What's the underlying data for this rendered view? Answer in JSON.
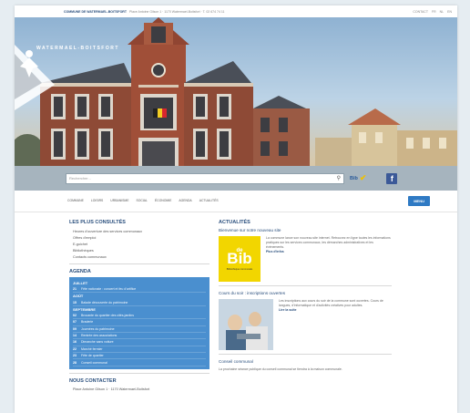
{
  "topbar": {
    "municipality": "COMMUNE DE WATERMAEL-BOITSFORT",
    "address": "Place Antoine Gilson 1 · 1170 Watermael-Boitsfort · T. 02 674 74 11",
    "right_links": [
      "CONTACT",
      "FR",
      "NL",
      "EN"
    ]
  },
  "hero": {
    "logo_text": "WATERMAEL-BOITSFORT"
  },
  "search": {
    "placeholder": "Rechercher...",
    "bib_label": "Bib"
  },
  "nav": {
    "items": [
      "COMMUNE",
      "LOISIRS",
      "URBANISME",
      "SOCIAL",
      "ÉCONOMIE",
      "AGENDA",
      "ACTUALITÉS"
    ],
    "menu_button": "MENU"
  },
  "left": {
    "most_consulted": {
      "title": "LES PLUS CONSULTÉS",
      "items": [
        "Heures d'ouverture des services communaux",
        "Offres d'emploi",
        "E-guichet",
        "Bibliothèques",
        "Contacts communaux"
      ]
    },
    "agenda": {
      "title": "AGENDA",
      "months": [
        {
          "name": "JUILLET",
          "events": [
            {
              "day": "21",
              "title": "Fête nationale : concert et feu d'artifice"
            }
          ]
        },
        {
          "name": "AOÛT",
          "events": [
            {
              "day": "15",
              "title": "Balade découverte du patrimoine"
            }
          ]
        },
        {
          "name": "SEPTEMBRE",
          "events": [
            {
              "day": "02",
              "title": "Brocante du quartier des cités-jardins"
            },
            {
              "day": "07",
              "title": "Braderie"
            },
            {
              "day": "09",
              "title": "Journées du patrimoine"
            },
            {
              "day": "14",
              "title": "Rentrée des associations"
            },
            {
              "day": "16",
              "title": "Dimanche sans voiture"
            },
            {
              "day": "22",
              "title": "Marché fermier"
            },
            {
              "day": "23",
              "title": "Fête de quartier"
            },
            {
              "day": "28",
              "title": "Conseil communal"
            }
          ]
        }
      ]
    },
    "contact": {
      "title": "NOUS CONTACTER",
      "text": "Place Antoine Gilson 1 · 1170 Watermael-Boitsfort"
    }
  },
  "right": {
    "news_title": "ACTUALITÉS",
    "item1": {
      "title": "Bienvenue sur notre nouveau site",
      "bib_de": "de",
      "bib_name": "Bib",
      "bib_sub": "Bibliothèque communale",
      "body": "La commune lance son nouveau site internet. Retrouvez en ligne toutes les informations pratiques sur les services communaux, les démarches administratives et les événements.",
      "link": "Plus d'infos"
    },
    "item2": {
      "title": "Cours du soir : inscriptions ouvertes",
      "body": "Les inscriptions aux cours du soir de la commune sont ouvertes. Cours de langues, d'informatique et d'activités créatives pour adultes.",
      "link": "Lire la suite"
    },
    "item3": {
      "title": "Conseil communal",
      "body": "La prochaine séance publique du conseil communal se tiendra à la maison communale."
    }
  },
  "colors": {
    "accent": "#2f7ac4",
    "agenda_bg": "#4a8fcf",
    "bib_yellow": "#f2d600",
    "facebook": "#3b5998"
  }
}
